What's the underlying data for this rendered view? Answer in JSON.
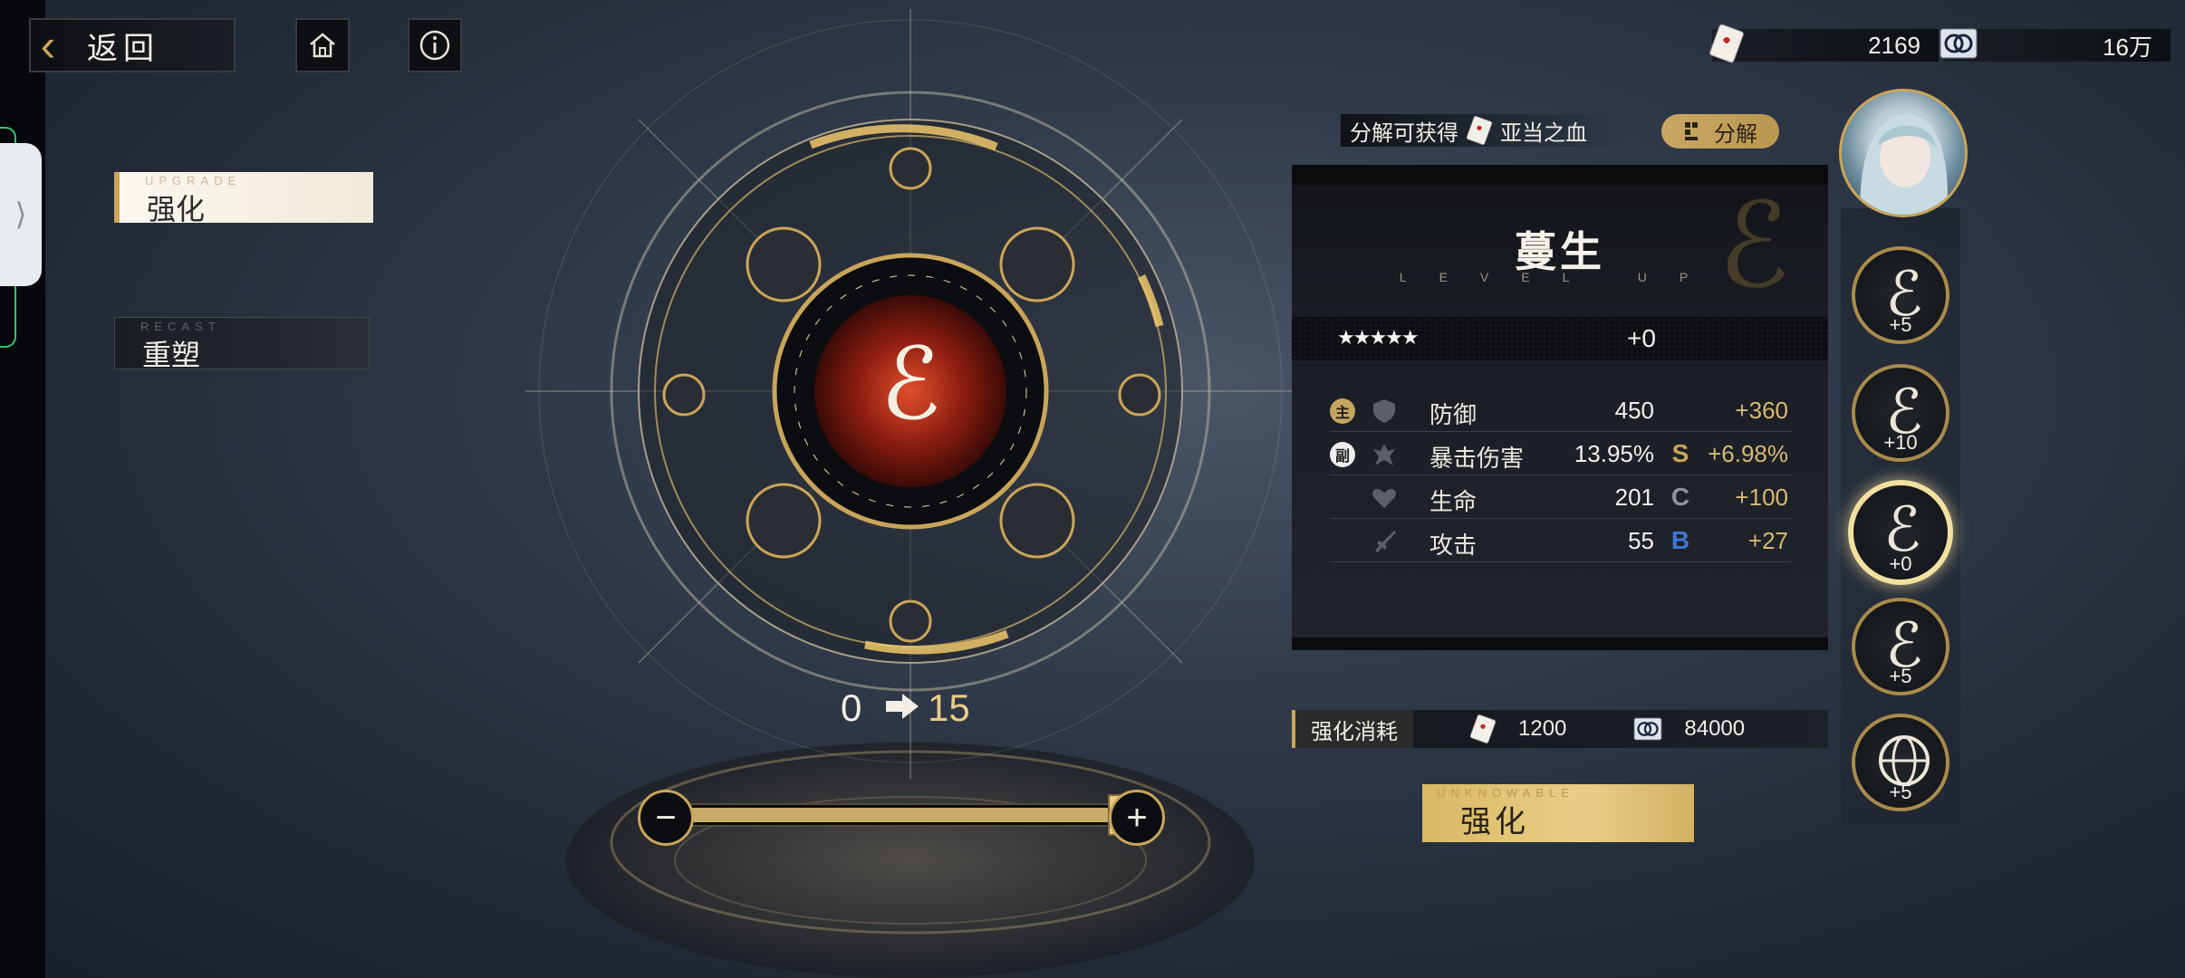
{
  "nav": {
    "back_label": "返回"
  },
  "currency": [
    {
      "name": "adam-blood",
      "value": "2169"
    },
    {
      "name": "coin",
      "value": "16万"
    }
  ],
  "tabs": [
    {
      "sub": "UPGRADE",
      "label": "强化",
      "active": true
    },
    {
      "sub": "RECAST",
      "label": "重塑",
      "active": false
    }
  ],
  "dismantle": {
    "note_prefix": "分解可获得",
    "note_item": "亚当之血",
    "button_label": "分解"
  },
  "item": {
    "name": "蔓生",
    "subtitle": "LEVEL UP",
    "stars": "★★★★★",
    "level_bonus": "+0",
    "stats": [
      {
        "badge": "主",
        "icon": "shield-icon",
        "name": "防御",
        "value": "450",
        "sub_icon": "",
        "increase": "+360"
      },
      {
        "badge": "副",
        "icon": "crit-icon",
        "name": "暴击伤害",
        "value": "13.95%",
        "sub_icon": "S",
        "increase": "+6.98%"
      },
      {
        "badge": "",
        "icon": "heart-icon",
        "name": "生命",
        "value": "201",
        "sub_icon": "C",
        "increase": "+100"
      },
      {
        "badge": "",
        "icon": "sword-icon",
        "name": "攻击",
        "value": "55",
        "sub_icon": "B",
        "increase": "+27"
      }
    ]
  },
  "level": {
    "from": "0",
    "to": "15",
    "slider_fraction": 1.0
  },
  "cost": {
    "label": "强化消耗",
    "blood": "1200",
    "coin": "84000"
  },
  "upgrade_button": {
    "sub": "UNKNOWABLE",
    "label": "强化"
  },
  "equipment_column": [
    {
      "level": "+5",
      "selected": false
    },
    {
      "level": "+10",
      "selected": false
    },
    {
      "level": "+0",
      "selected": true
    },
    {
      "level": "+5",
      "selected": false
    },
    {
      "level": "+5",
      "selected": false
    }
  ],
  "colors": {
    "gold": "#c9a55a",
    "highlight": "#e9cc86",
    "bg": "#2b3442"
  }
}
